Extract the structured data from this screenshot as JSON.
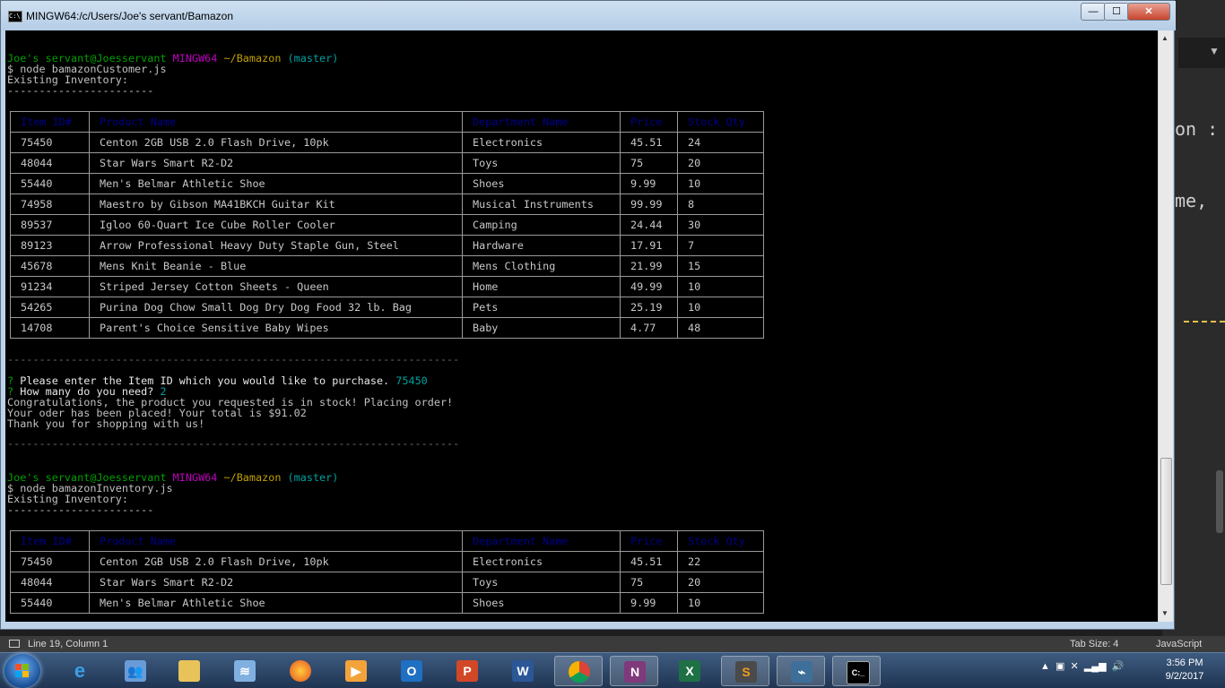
{
  "window": {
    "title": "MINGW64:/c/Users/Joe's servant/Bamazon",
    "app_icon_text": "C:\\",
    "minimize": "—",
    "maximize": "☐",
    "close": "✕"
  },
  "background_editor": {
    "fragments": [
      "on :",
      "me,"
    ]
  },
  "terminal": {
    "session1": {
      "prompt_user": "Joe's servant@Joesservant",
      "prompt_env": "MINGW64",
      "prompt_path": "~/Bamazon",
      "prompt_branch": "(master)",
      "command": "$ node bamazonCustomer.js",
      "heading": "Existing Inventory:",
      "rule": "-----------------------",
      "question1_mark": "?",
      "question1": " Please enter the Item ID which you would like to purchase.",
      "answer1": " 75450",
      "question2": " How many do you need?",
      "answer2": " 2",
      "msg1": "Congratulations, the product you requested is in stock! Placing order!",
      "msg2": "Your oder has been placed! Your total is $91.02",
      "msg3": "Thank you for shopping with us!",
      "long_rule": "-----------------------------------------------------------------------"
    },
    "session2": {
      "prompt_user": "Joe's servant@Joesservant",
      "prompt_env": "MINGW64",
      "prompt_path": "~/Bamazon",
      "prompt_branch": "(master)",
      "command": "$ node bamazonInventory.js",
      "heading": "Existing Inventory:",
      "rule": "-----------------------"
    },
    "table_headers": [
      "Item ID#",
      "Product Name",
      "Department Name",
      "Price",
      "Stock Qty"
    ],
    "table1_rows": [
      [
        "75450",
        "Centon 2GB USB 2.0 Flash Drive, 10pk",
        "Electronics",
        "45.51",
        "24"
      ],
      [
        "48044",
        "Star Wars Smart R2-D2",
        "Toys",
        "75",
        "20"
      ],
      [
        "55440",
        "Men's Belmar Athletic Shoe",
        "Shoes",
        "9.99",
        "10"
      ],
      [
        "74958",
        "Maestro by Gibson MA41BKCH Guitar Kit",
        "Musical Instruments",
        "99.99",
        "8"
      ],
      [
        "89537",
        "Igloo 60-Quart Ice Cube Roller Cooler",
        "Camping",
        "24.44",
        "30"
      ],
      [
        "89123",
        "Arrow Professional Heavy Duty Staple Gun, Steel",
        "Hardware",
        "17.91",
        "7"
      ],
      [
        "45678",
        "Mens Knit Beanie - Blue",
        "Mens Clothing",
        "21.99",
        "15"
      ],
      [
        "91234",
        "Striped Jersey Cotton Sheets - Queen",
        "Home",
        "49.99",
        "10"
      ],
      [
        "54265",
        "Purina Dog Chow Small Dog Dry Dog Food 32 lb. Bag",
        "Pets",
        "25.19",
        "10"
      ],
      [
        "14708",
        "Parent's Choice Sensitive Baby Wipes",
        "Baby",
        "4.77",
        "48"
      ]
    ],
    "table2_rows": [
      [
        "75450",
        "Centon 2GB USB 2.0 Flash Drive, 10pk",
        "Electronics",
        "45.51",
        "22"
      ],
      [
        "48044",
        "Star Wars Smart R2-D2",
        "Toys",
        "75",
        "20"
      ],
      [
        "55440",
        "Men's Belmar Athletic Shoe",
        "Shoes",
        "9.99",
        "10"
      ]
    ]
  },
  "statusbar": {
    "position": "Line 19, Column 1",
    "tab_size": "Tab Size: 4",
    "syntax": "JavaScript"
  },
  "taskbar": {
    "icons": [
      "windows-start-icon",
      "internet-explorer-icon",
      "network-people-icon",
      "file-explorer-icon",
      "wifi-folder-icon",
      "firefox-icon",
      "media-player-icon",
      "outlook-icon",
      "powerpoint-icon",
      "word-icon",
      "chrome-icon",
      "onenote-icon",
      "excel-icon",
      "sublime-text-icon",
      "mysql-workbench-icon",
      "terminal-icon"
    ],
    "clock_time": "3:56 PM",
    "clock_date": "9/2/2017"
  }
}
